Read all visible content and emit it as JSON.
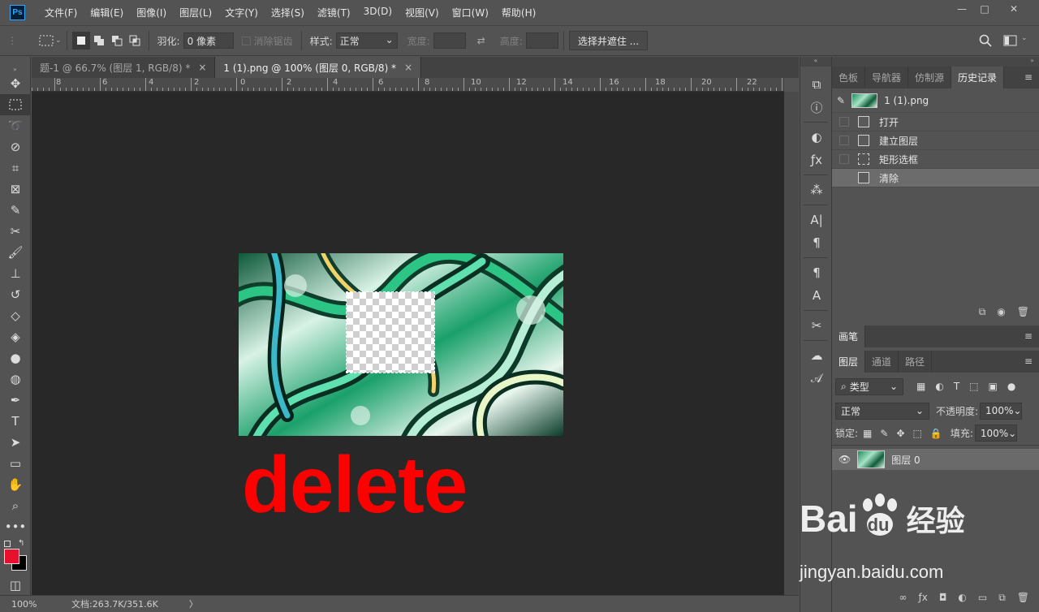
{
  "app": {
    "logo": "Ps"
  },
  "menu": [
    "文件(F)",
    "编辑(E)",
    "图像(I)",
    "图层(L)",
    "文字(Y)",
    "选择(S)",
    "滤镜(T)",
    "3D(D)",
    "视图(V)",
    "窗口(W)",
    "帮助(H)"
  ],
  "window_controls": {
    "minimize": "—",
    "maximize": "□",
    "close": "✕"
  },
  "options": {
    "feather_label": "羽化:",
    "feather_value": "0 像素",
    "antialias_label": "消除锯齿",
    "style_label": "样式:",
    "style_value": "正常",
    "width_label": "宽度:",
    "height_label": "高度:",
    "select_mask_label": "选择并遮住 ..."
  },
  "tabs": [
    {
      "label": "题-1 @ 66.7% (图层 1, RGB/8) *",
      "close": "×"
    },
    {
      "label": "1 (1).png @ 100% (图层 0, RGB/8) *",
      "close": "×"
    }
  ],
  "ruler": [
    "8",
    "6",
    "4",
    "2",
    "0",
    "2",
    "4",
    "6",
    "8",
    "10",
    "12",
    "14",
    "16",
    "18",
    "20",
    "22"
  ],
  "canvas": {
    "overlay_text": "delete",
    "overlay_color": "#ff0000"
  },
  "status": {
    "zoom": "100%",
    "doc_info": "文档:263.7K/351.6K",
    "arrow": "〉"
  },
  "history_panel": {
    "tabs": [
      "色板",
      "导航器",
      "仿制源",
      "历史记录"
    ],
    "snapshot": "1 (1).png",
    "items": [
      "打开",
      "建立图层",
      "矩形选框",
      "清除"
    ]
  },
  "brush_panel": {
    "tab": "画笔"
  },
  "layers_panel": {
    "tabs": [
      "图层",
      "通道",
      "路径"
    ],
    "filter_label": "类型",
    "blend_mode": "正常",
    "opacity_label": "不透明度:",
    "opacity_value": "100%",
    "lock_label": "锁定:",
    "fill_label": "填充:",
    "fill_value": "100%",
    "layers": [
      {
        "name": "图层 0"
      }
    ]
  },
  "watermark": {
    "brand": "Bai",
    "brand_tail": "du",
    "cn": "经验",
    "url": "jingyan.baidu.com"
  },
  "colors": {
    "foreground": "#e8112d",
    "background": "#000000"
  }
}
